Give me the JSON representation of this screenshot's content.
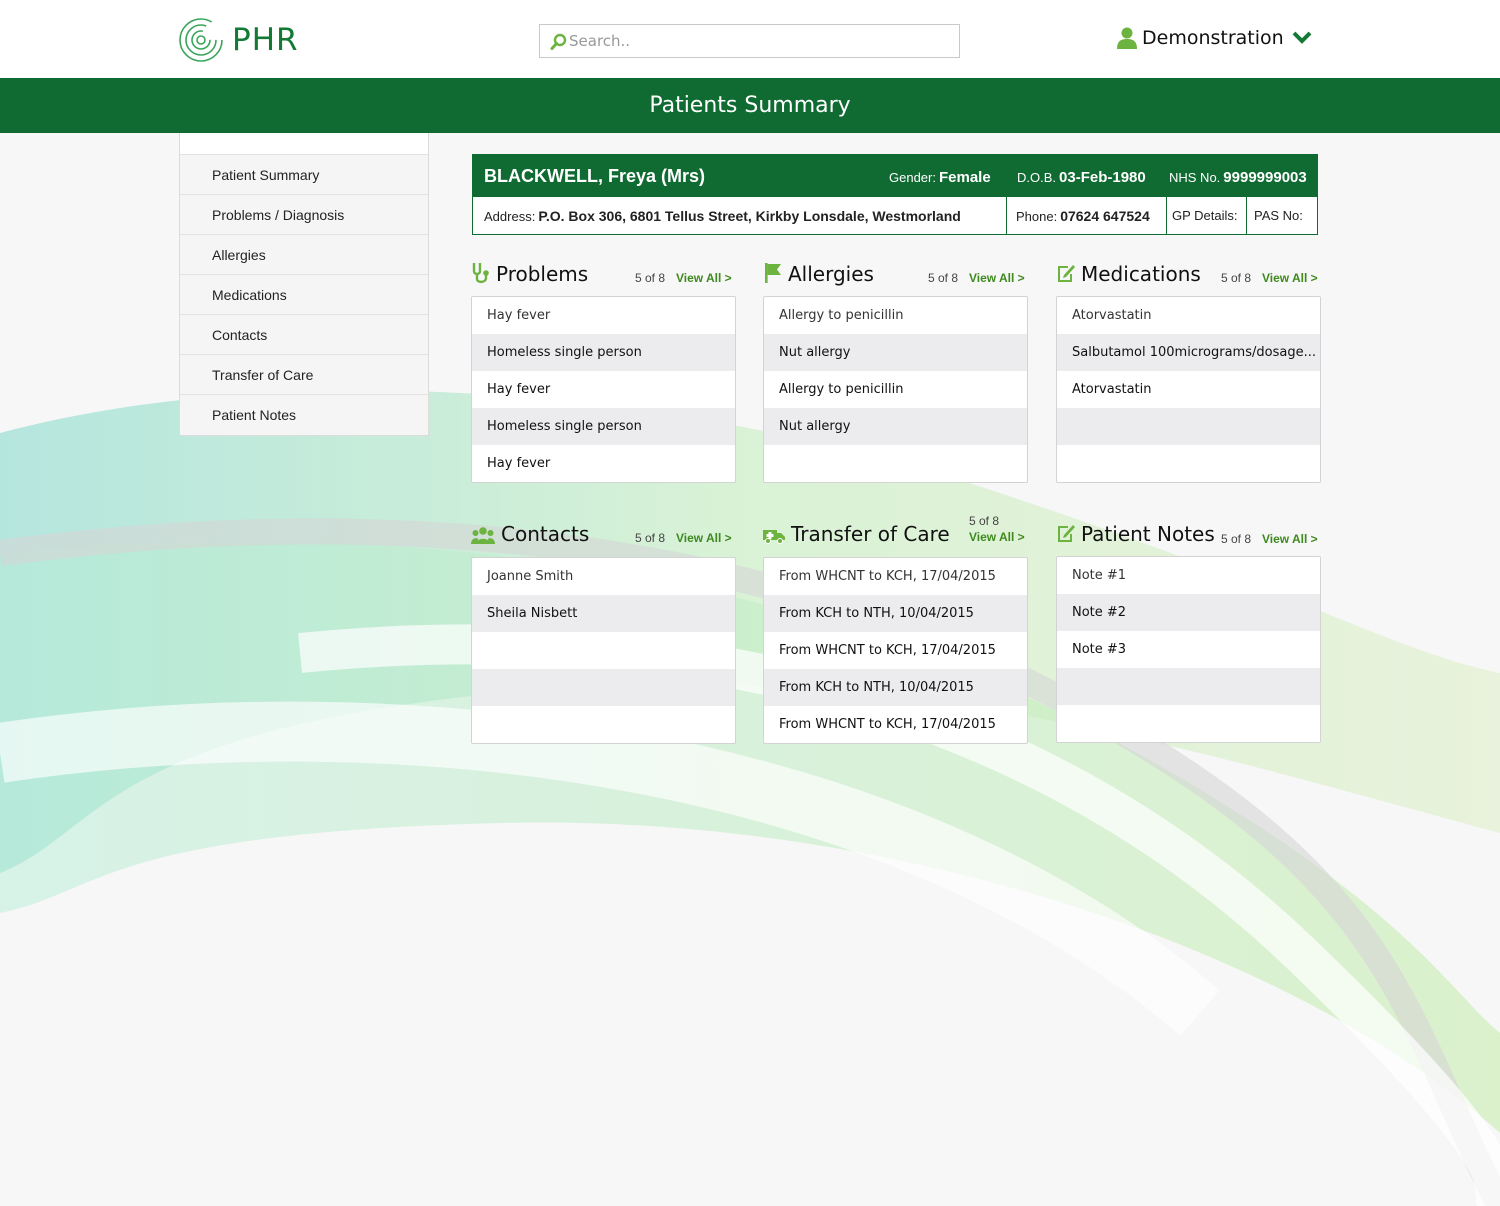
{
  "app": {
    "logo_text": "PHR"
  },
  "search": {
    "placeholder": "Search.."
  },
  "user": {
    "name": "Demonstration"
  },
  "page_title": "Patients Summary",
  "sidebar": {
    "items": [
      {
        "label": "Patient Summary"
      },
      {
        "label": "Problems / Diagnosis"
      },
      {
        "label": "Allergies"
      },
      {
        "label": "Medications"
      },
      {
        "label": "Contacts"
      },
      {
        "label": "Transfer of Care"
      },
      {
        "label": "Patient Notes"
      }
    ]
  },
  "patient": {
    "name": "BLACKWELL, Freya (Mrs)",
    "gender_label": "Gender:",
    "gender": "Female",
    "dob_label": "D.O.B.",
    "dob": "03-Feb-1980",
    "nhs_label": "NHS No.",
    "nhs": "9999999003",
    "address_label": "Address:",
    "address": "P.O. Box 306, 6801 Tellus Street, Kirkby Lonsdale, Westmorland",
    "phone_label": "Phone:",
    "phone": "07624 647524",
    "gp_label": "GP Details:",
    "pas_label": "PAS No:"
  },
  "panels": {
    "problems": {
      "title": "Problems",
      "count": "5 of 8",
      "view_all": "View All >",
      "items": [
        "Hay fever",
        "Homeless single person",
        "Hay fever",
        "Homeless single person",
        "Hay fever"
      ]
    },
    "allergies": {
      "title": "Allergies",
      "count": "5 of 8",
      "view_all": "View All >",
      "items": [
        "Allergy to penicillin",
        "Nut allergy",
        "Allergy to penicillin",
        "Nut allergy",
        ""
      ]
    },
    "medications": {
      "title": "Medications",
      "count": "5 of 8",
      "view_all": "View All >",
      "items": [
        "Atorvastatin",
        "Salbutamol 100micrograms/dosage...",
        "Atorvastatin",
        "",
        ""
      ]
    },
    "contacts": {
      "title": "Contacts",
      "count": "5 of 8",
      "view_all": "View All >",
      "items": [
        "Joanne Smith",
        "Sheila Nisbett",
        "",
        "",
        ""
      ]
    },
    "transfer": {
      "title": "Transfer of Care",
      "count": "5 of 8",
      "view_all": "View All >",
      "items": [
        "From WHCNT to KCH, 17/04/2015",
        "From KCH to NTH, 10/04/2015",
        "From WHCNT to KCH, 17/04/2015",
        "From KCH to NTH, 10/04/2015",
        "From WHCNT to KCH, 17/04/2015"
      ]
    },
    "notes": {
      "title": "Patient Notes",
      "count": "5 of 8",
      "view_all": "View All >",
      "items": [
        "Note #1",
        "Note #2",
        "Note #3",
        "",
        ""
      ]
    }
  },
  "colors": {
    "brand_green": "#106b33",
    "accent_green": "#3f8a1f",
    "icon_green": "#6cb33f"
  },
  "icons": [
    "search-icon",
    "user-icon",
    "chevron-down-icon",
    "stethoscope-icon",
    "flag-icon",
    "edit-icon",
    "group-icon",
    "ambulance-icon"
  ]
}
